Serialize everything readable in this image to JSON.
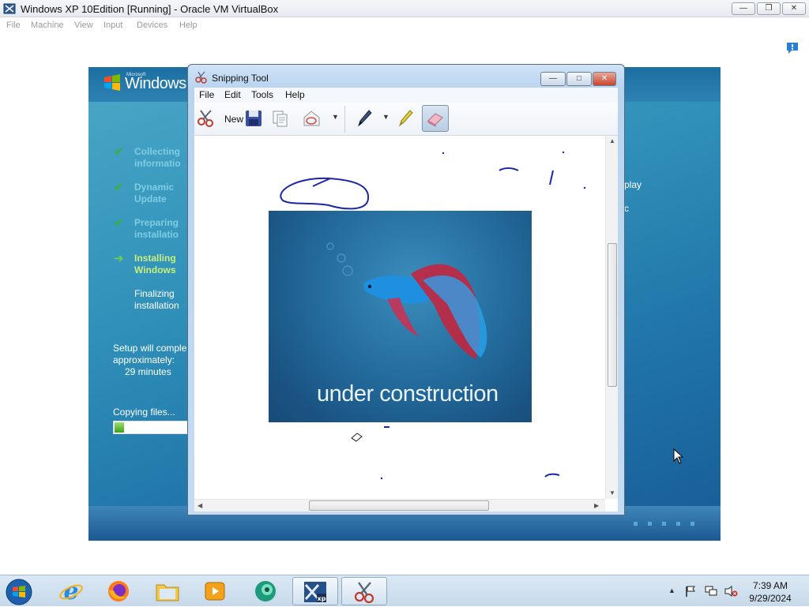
{
  "vbox": {
    "title": "Windows XP 10Edition [Running] - Oracle VM VirtualBox",
    "menu": [
      "File",
      "Machine",
      "View",
      "Input",
      "Devices",
      "Help"
    ]
  },
  "guest": {
    "logo_small": "Microsoft",
    "logo_text": "Windows",
    "steps": [
      {
        "line1": "Collecting",
        "line2": "informatio",
        "state": "done"
      },
      {
        "line1": "Dynamic",
        "line2": "Update",
        "state": "done"
      },
      {
        "line1": "Preparing",
        "line2": "installatio",
        "state": "done"
      },
      {
        "line1": "Installing",
        "line2": "Windows",
        "state": "current"
      },
      {
        "line1": "Finalizing",
        "line2": "installation",
        "state": "pending"
      }
    ],
    "remaining_l1": "Setup will comple",
    "remaining_l2": "approximately:",
    "remaining_min": "29 minutes",
    "copy_label": "Copying files...",
    "progress": 0.12,
    "right_text_1": "play",
    "right_text_2": "c"
  },
  "snip": {
    "title": "Snipping Tool",
    "menu": [
      "File",
      "Edit",
      "Tools",
      "Help"
    ],
    "new_label": "New",
    "image_text": "under construction"
  },
  "taskbar": {
    "time": "7:39 AM",
    "date": "9/29/2024"
  },
  "colors": {
    "accent_green": "#3fa11a",
    "check_green": "#38b32f",
    "pen_blue": "#1b27a8"
  }
}
